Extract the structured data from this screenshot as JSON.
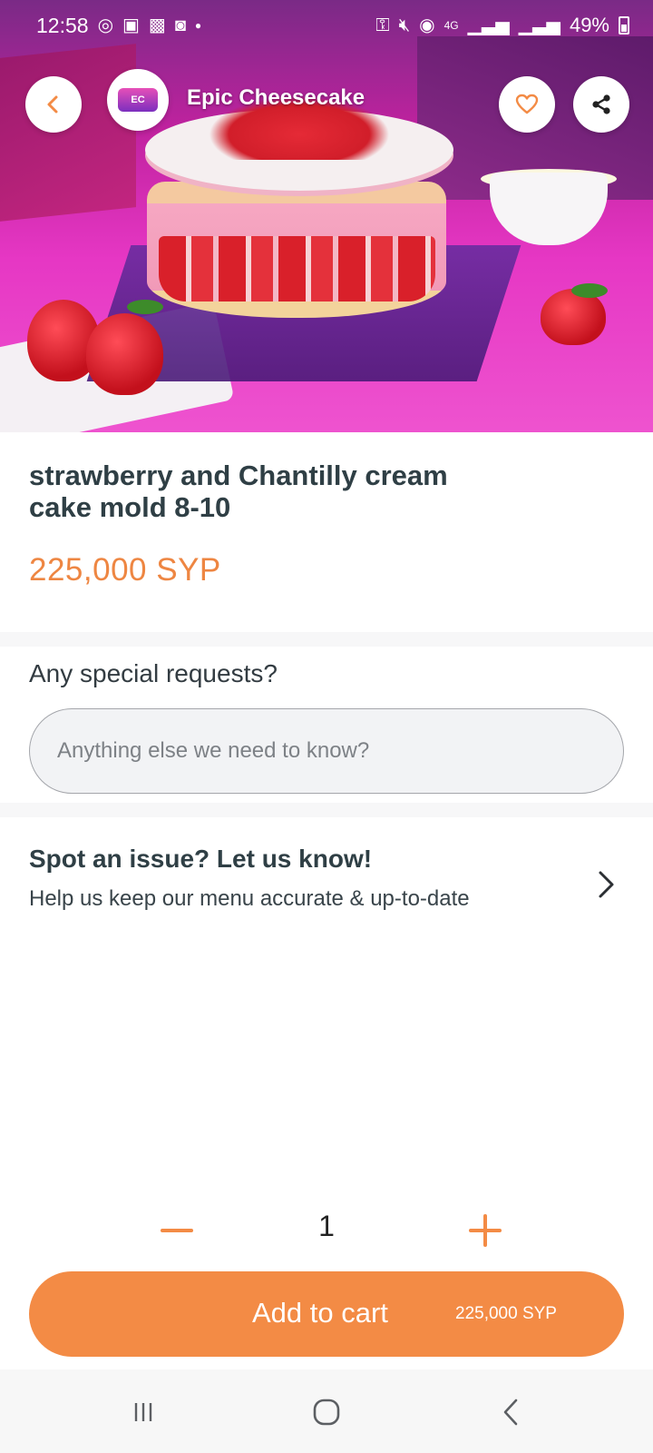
{
  "status_bar": {
    "time": "12:58",
    "left_icons": [
      "instagram-icon",
      "facebook-icon",
      "app-icon",
      "app-icon",
      "dot-icon"
    ],
    "right_icons": [
      "key-icon",
      "mute-icon",
      "hotspot-icon",
      "4g-icon",
      "signal-icon",
      "signal-icon"
    ],
    "network": "4G",
    "battery": "49%"
  },
  "header": {
    "store_name": "Epic Cheesecake",
    "back_icon": "chevron-left-icon",
    "favorite_icon": "heart-icon",
    "share_icon": "share-icon"
  },
  "product": {
    "title": "strawberry and Chantilly cream cake mold 8-10",
    "price": "225,000 SYP"
  },
  "special_requests": {
    "label": "Any special requests?",
    "placeholder": "Anything else we need to know?",
    "value": ""
  },
  "issue": {
    "title": "Spot an issue? Let us know!",
    "subtitle": "Help us keep our menu accurate & up-to-date"
  },
  "quantity": {
    "value": "1"
  },
  "cart": {
    "label": "Add to cart",
    "price": "225,000 SYP"
  },
  "colors": {
    "accent": "#F38B45",
    "price": "#EE8642",
    "title": "#2F3F45"
  }
}
